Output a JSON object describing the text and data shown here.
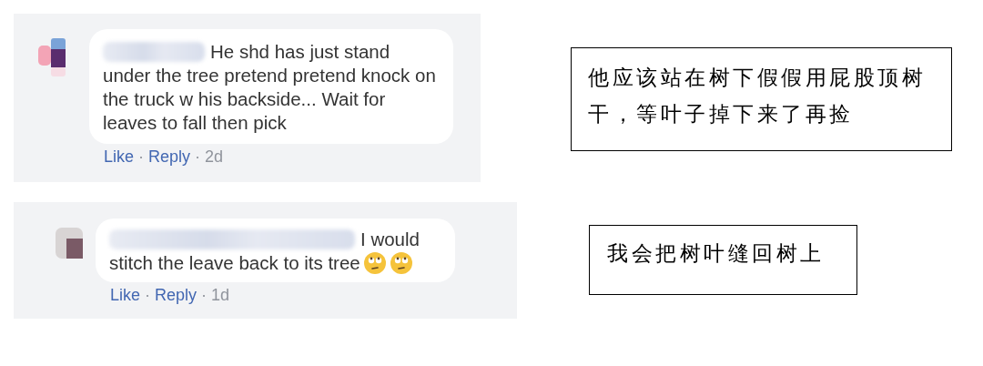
{
  "rows": [
    {
      "comment": {
        "name_redacted": true,
        "text_parts": [
          "He shd has just stand",
          "under the tree pretend pretend knock on the truck w his backside... Wait for leaves to fall then pick"
        ],
        "actions": [
          "Like",
          "Reply"
        ],
        "separator": "·",
        "time": "2d"
      },
      "translation": "他应该站在树下假假用屁股顶树干，等叶子掉下来了再捡"
    },
    {
      "comment": {
        "name_redacted": true,
        "text_parts": [
          "I would",
          "stitch the leave back to its tree"
        ],
        "emojis": [
          {
            "kind": "rolling-eyes"
          },
          {
            "kind": "rolling-eyes"
          }
        ],
        "actions": [
          "Like",
          "Reply"
        ],
        "separator": "·",
        "time": "1d"
      },
      "translation": "我会把树叶缝回树上"
    }
  ]
}
